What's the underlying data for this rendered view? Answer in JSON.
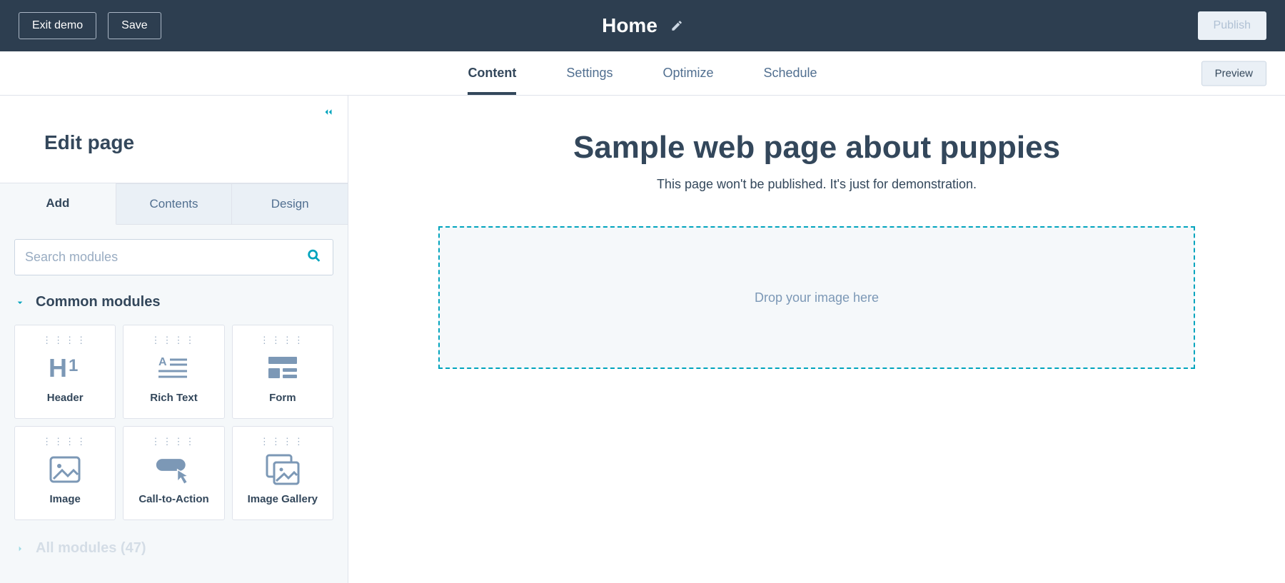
{
  "topbar": {
    "exit_label": "Exit demo",
    "save_label": "Save",
    "page_title": "Home",
    "publish_label": "Publish"
  },
  "navtabs": {
    "items": [
      {
        "label": "Content",
        "active": true
      },
      {
        "label": "Settings",
        "active": false
      },
      {
        "label": "Optimize",
        "active": false
      },
      {
        "label": "Schedule",
        "active": false
      }
    ],
    "preview_label": "Preview"
  },
  "sidebar": {
    "heading": "Edit page",
    "tabs": [
      {
        "label": "Add",
        "active": true
      },
      {
        "label": "Contents",
        "active": false
      },
      {
        "label": "Design",
        "active": false
      }
    ],
    "search_placeholder": "Search modules",
    "sections": {
      "common": {
        "title": "Common modules",
        "expanded": true,
        "modules": [
          {
            "label": "Header",
            "icon": "header-icon"
          },
          {
            "label": "Rich Text",
            "icon": "rich-text-icon"
          },
          {
            "label": "Form",
            "icon": "form-icon"
          },
          {
            "label": "Image",
            "icon": "image-icon"
          },
          {
            "label": "Call-to-Action",
            "icon": "cta-icon"
          },
          {
            "label": "Image Gallery",
            "icon": "gallery-icon"
          }
        ]
      },
      "all": {
        "title": "All modules (47)",
        "expanded": false
      }
    }
  },
  "canvas": {
    "heading": "Sample web page about puppies",
    "subtext": "This page won't be published. It's just for demonstration.",
    "dropzone_label": "Drop your image here"
  }
}
